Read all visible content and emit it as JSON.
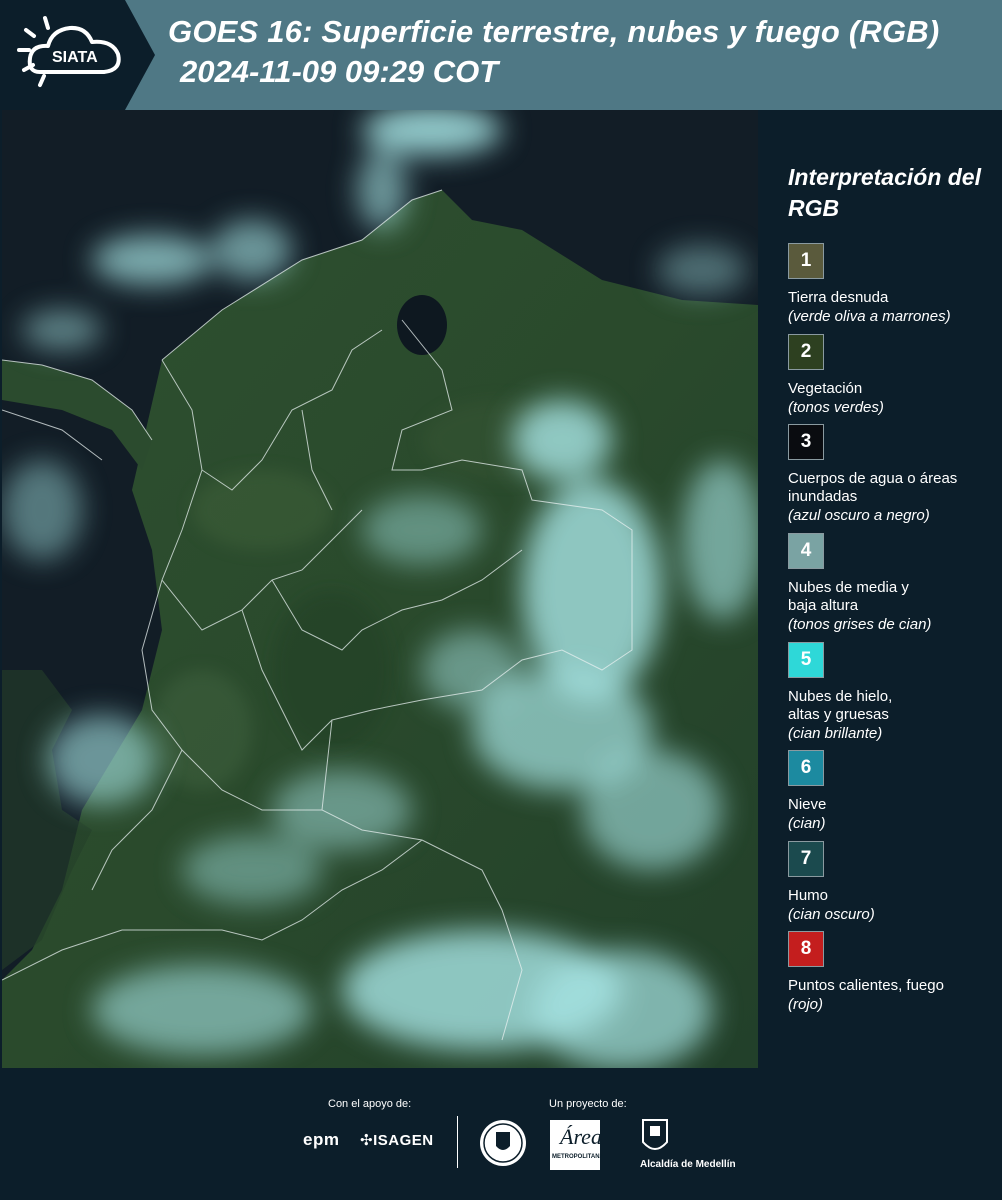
{
  "header": {
    "logo_text": "SIATA",
    "title_line1": "GOES 16: Superficie terrestre, nubes y fuego (RGB)",
    "title_line2": "2024-11-09 09:29 COT"
  },
  "legend": {
    "title": "Interpretación del RGB",
    "items": [
      {
        "number": "1",
        "name": "Tierra desnuda",
        "desc": "(verde oliva a marrones)",
        "color": "#5a5a3c"
      },
      {
        "number": "2",
        "name": "Vegetación",
        "desc": "(tonos verdes)",
        "color": "#2d4020"
      },
      {
        "number": "3",
        "name": "Cuerpos de agua o áreas inundadas",
        "desc": "(azul oscuro a negro)",
        "color": "#0a0c10"
      },
      {
        "number": "4",
        "name": "Nubes de media y baja altura",
        "desc": "(tonos grises de cian)",
        "color": "#7aa3a3"
      },
      {
        "number": "5",
        "name": "Nubes de hielo, altas y gruesas",
        "desc": "(cian brillante)",
        "color": "#2ed8d8"
      },
      {
        "number": "6",
        "name": "Nieve",
        "desc": "(cian)",
        "color": "#1c8aa0"
      },
      {
        "number": "7",
        "name": "Humo",
        "desc": "(cian oscuro)",
        "color": "#1b4a4e"
      },
      {
        "number": "8",
        "name": "Puntos calientes, fuego",
        "desc": "(rojo)",
        "color": "#c41e1e"
      }
    ]
  },
  "footer": {
    "support_label": "Con el apoyo de:",
    "project_label": "Un proyecto de:",
    "sponsor1": "epm",
    "sponsor2": "ISAGEN",
    "partner_area": "Área",
    "partner_area_sub": "METROPOLITANA",
    "partner_alcaldia": "Alcaldía de Medellín"
  },
  "colors": {
    "header_bg": "#4f7885",
    "logo_bg": "#0c1e2a",
    "page_bg": "#0c1e2a"
  }
}
